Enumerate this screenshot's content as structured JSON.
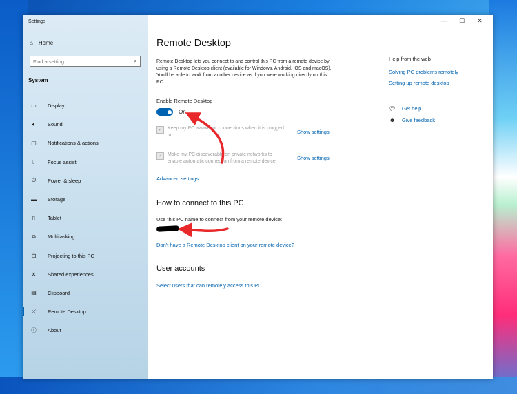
{
  "window": {
    "title": "Settings",
    "controls": [
      "—",
      "☐",
      "✕"
    ]
  },
  "sidebar": {
    "home": {
      "icon": "home-icon",
      "label": "Home"
    },
    "search": {
      "placeholder": "Find a setting"
    },
    "section": "System",
    "items": [
      {
        "icon": "display-icon",
        "label": "Display"
      },
      {
        "icon": "sound-icon",
        "label": "Sound"
      },
      {
        "icon": "notifications-icon",
        "label": "Notifications & actions"
      },
      {
        "icon": "focus-assist-icon",
        "label": "Focus assist"
      },
      {
        "icon": "power-icon",
        "label": "Power & sleep"
      },
      {
        "icon": "storage-icon",
        "label": "Storage"
      },
      {
        "icon": "tablet-icon",
        "label": "Tablet"
      },
      {
        "icon": "multitasking-icon",
        "label": "Multitasking"
      },
      {
        "icon": "projecting-icon",
        "label": "Projecting to this PC"
      },
      {
        "icon": "shared-experiences-icon",
        "label": "Shared experiences"
      },
      {
        "icon": "clipboard-icon",
        "label": "Clipboard"
      },
      {
        "icon": "remote-desktop-icon",
        "label": "Remote Desktop"
      },
      {
        "icon": "about-icon",
        "label": "About"
      }
    ]
  },
  "main": {
    "title": "Remote Desktop",
    "description": "Remote Desktop lets you connect to and control this PC from a remote device by using a Remote Desktop client (available for Windows, Android, iOS and macOS). You'll be able to work from another device as if you were working directly on this PC.",
    "enable_label": "Enable Remote Desktop",
    "toggle_state": "On",
    "options": [
      {
        "text": "Keep my PC awake for connections when it is plugged in",
        "link": "Show settings"
      },
      {
        "text": "Make my PC discoverable on private networks to enable automatic connection from a remote device",
        "link": "Show settings"
      }
    ],
    "advanced_link": "Advanced settings",
    "connect_heading": "How to connect to this PC",
    "connect_text": "Use this PC name to connect from your remote device:",
    "client_link": "Don't have a Remote Desktop client on your remote device?",
    "accounts_heading": "User accounts",
    "accounts_link": "Select users that can remotely access this PC"
  },
  "help": {
    "title": "Help from the web",
    "links": [
      "Solving PC problems remotely",
      "Setting up remote desktop"
    ],
    "get_help": "Get help",
    "feedback": "Give feedback"
  },
  "colors": {
    "accent": "#0063b1",
    "annotation": "#e8282b"
  }
}
